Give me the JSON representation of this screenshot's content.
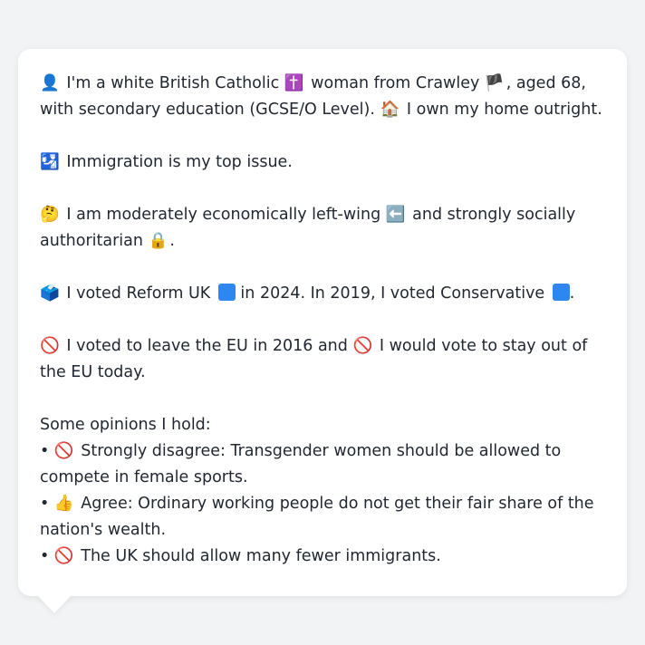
{
  "colors": {
    "background": "#f1f3f5",
    "card": "#ffffff",
    "text": "#222831",
    "party_reform": "#2e86f0",
    "party_conservative": "#2e86f0"
  },
  "lines": {
    "identity": {
      "icon": "👤",
      "text_a": "I'm a white British Catholic",
      "icon_religion": "✝️",
      "text_b": "woman from Crawley",
      "icon_flag": "🏴",
      "text_c": ", aged 68, with secondary education (GCSE/O Level).",
      "icon_home": "🏠",
      "text_d": "I own my home outright."
    },
    "top_issue": {
      "icon": "🛂",
      "text": "Immigration is my top issue."
    },
    "ideology": {
      "icon": "🤔",
      "text_a": "I am moderately economically left-wing",
      "icon_left": "⬅️",
      "text_b": "and strongly socially authoritarian",
      "icon_lock": "🔒",
      "text_c": "."
    },
    "votes": {
      "icon": "🗳️",
      "text_a": "I voted Reform UK",
      "text_b": "in 2024. In 2019, I voted Conservative",
      "text_c": "."
    },
    "eu": {
      "icon": "🚫",
      "text_a": "I voted to leave the EU in 2016 and",
      "icon_b": "🚫",
      "text_b": "I would vote to stay out of the EU today."
    }
  },
  "opinions": {
    "heading": "Some opinions I hold:",
    "bullet": "•",
    "items": [
      {
        "icon": "🚫",
        "text": "Strongly disagree: Transgender women should be allowed to compete in female sports."
      },
      {
        "icon": "👍",
        "text": "Agree: Ordinary working people do not get their fair share of the nation's wealth."
      },
      {
        "icon": "🚫",
        "text": "The UK should allow many fewer immigrants."
      }
    ]
  }
}
